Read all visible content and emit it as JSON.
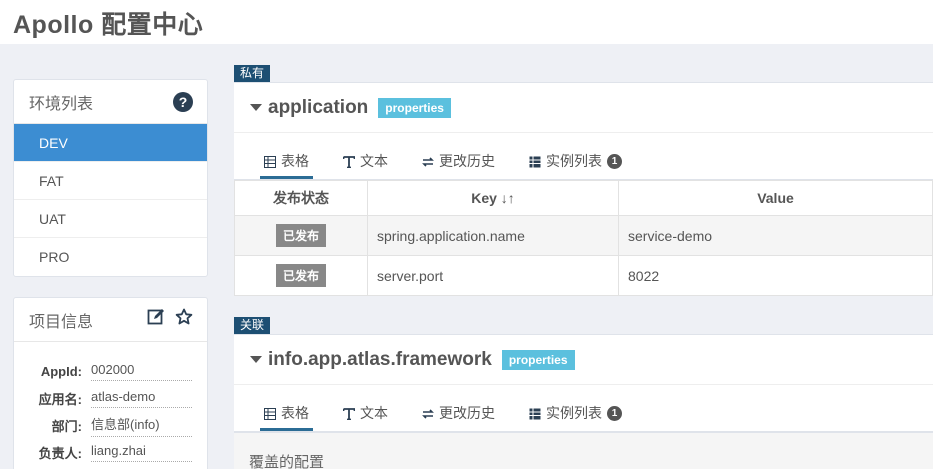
{
  "app": {
    "title": "Apollo 配置中心"
  },
  "env_panel": {
    "title": "环境列表",
    "help_icon": "question-circle-icon",
    "items": [
      {
        "label": "DEV",
        "active": true
      },
      {
        "label": "FAT",
        "active": false
      },
      {
        "label": "UAT",
        "active": false
      },
      {
        "label": "PRO",
        "active": false
      }
    ]
  },
  "project_info": {
    "title": "项目信息",
    "edit_icon": "edit-icon",
    "favorite_icon": "star-icon",
    "fields": [
      {
        "label": "AppId:",
        "value": "002000"
      },
      {
        "label": "应用名:",
        "value": "atlas-demo"
      },
      {
        "label": "部门:",
        "value": "信息部(info)"
      },
      {
        "label": "负责人:",
        "value": "liang.zhai"
      }
    ]
  },
  "namespaces": [
    {
      "tag": "私有",
      "name": "application",
      "format": "properties",
      "tabs": [
        {
          "label": "表格",
          "icon": "table-icon",
          "active": true
        },
        {
          "label": "文本",
          "icon": "text-icon",
          "active": false
        },
        {
          "label": "更改历史",
          "icon": "history-icon",
          "active": false
        },
        {
          "label": "实例列表",
          "icon": "instance-list-icon",
          "active": false,
          "badge": "1"
        }
      ],
      "table": {
        "headers": {
          "status": "发布状态",
          "key": "Key",
          "value": "Value"
        },
        "rows": [
          {
            "status": "已发布",
            "key": "spring.application.name",
            "value": "service-demo"
          },
          {
            "status": "已发布",
            "key": "server.port",
            "value": "8022"
          }
        ]
      }
    },
    {
      "tag": "关联",
      "name": "info.app.atlas.framework",
      "format": "properties",
      "tabs": [
        {
          "label": "表格",
          "icon": "table-icon",
          "active": true
        },
        {
          "label": "文本",
          "icon": "text-icon",
          "active": false
        },
        {
          "label": "更改历史",
          "icon": "history-icon",
          "active": false
        },
        {
          "label": "实例列表",
          "icon": "instance-list-icon",
          "active": false,
          "badge": "1"
        }
      ],
      "override_label": "覆盖的配置"
    }
  ],
  "colors": {
    "active_env": "#3c8dd2",
    "tag_bg": "#1d4f73",
    "format_badge": "#5bc0de",
    "published_badge": "#888888"
  }
}
